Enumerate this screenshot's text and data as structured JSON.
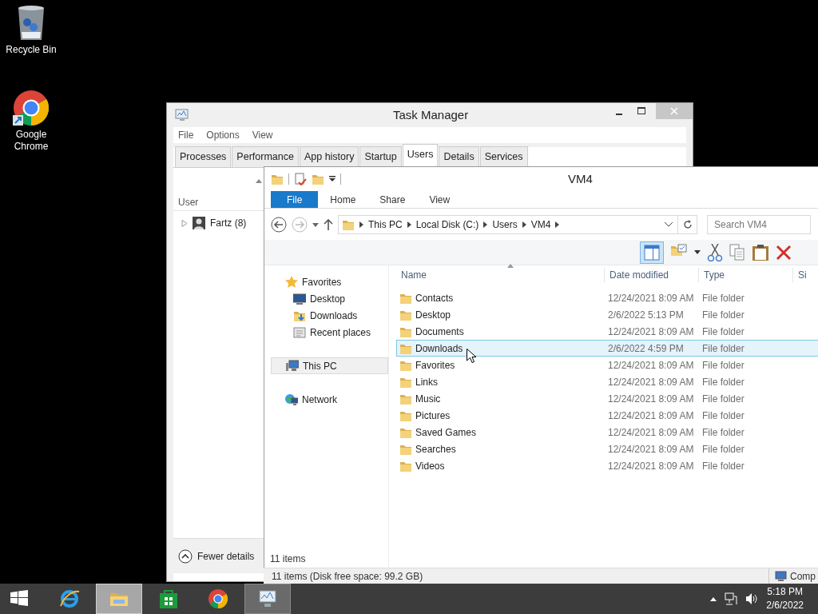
{
  "desktop_icons": [
    {
      "label": "Recycle Bin",
      "kind": "bin"
    },
    {
      "label": "Google Chrome",
      "kind": "chrome"
    }
  ],
  "task_manager": {
    "title": "Task Manager",
    "menu": [
      "File",
      "Options",
      "View"
    ],
    "tabs": [
      {
        "label": "Processes",
        "selected": false
      },
      {
        "label": "Performance",
        "selected": false
      },
      {
        "label": "App history",
        "selected": false
      },
      {
        "label": "Startup",
        "selected": false
      },
      {
        "label": "Users",
        "selected": true
      },
      {
        "label": "Details",
        "selected": false
      },
      {
        "label": "Services",
        "selected": false
      }
    ],
    "column": "User",
    "users": [
      {
        "name": "Fartz (8)",
        "expanded": false
      }
    ],
    "footer": "Fewer details"
  },
  "explorer": {
    "title": "VM4",
    "ribbon_tabs": [
      {
        "label": "File",
        "kind": "file"
      },
      {
        "label": "Home",
        "kind": "tab"
      },
      {
        "label": "Share",
        "kind": "tab"
      },
      {
        "label": "View",
        "kind": "tab"
      }
    ],
    "breadcrumbs": [
      "This PC",
      "Local Disk (C:)",
      "Users",
      "VM4"
    ],
    "search": {
      "placeholder": "Search VM4"
    },
    "nav": [
      {
        "label": "Favorites",
        "kind": "star",
        "selected": false,
        "children": [
          {
            "label": "Desktop",
            "kind": "desktop",
            "selected": false
          },
          {
            "label": "Downloads",
            "kind": "downloads",
            "selected": false
          },
          {
            "label": "Recent places",
            "kind": "recent",
            "selected": false
          }
        ]
      },
      {
        "label": "This PC",
        "kind": "pc",
        "selected": true
      },
      {
        "label": "Network",
        "kind": "network",
        "selected": false
      }
    ],
    "columns": [
      "Name",
      "Date modified",
      "Type",
      "Si"
    ],
    "rows": [
      {
        "name": "Contacts",
        "date": "12/24/2021 8:09 AM",
        "type": "File folder",
        "selected": false
      },
      {
        "name": "Desktop",
        "date": "2/6/2022 5:13 PM",
        "type": "File folder",
        "selected": false
      },
      {
        "name": "Documents",
        "date": "12/24/2021 8:09 AM",
        "type": "File folder",
        "selected": false
      },
      {
        "name": "Downloads",
        "date": "2/6/2022 4:59 PM",
        "type": "File folder",
        "selected": true
      },
      {
        "name": "Favorites",
        "date": "12/24/2021 8:09 AM",
        "type": "File folder",
        "selected": false
      },
      {
        "name": "Links",
        "date": "12/24/2021 8:09 AM",
        "type": "File folder",
        "selected": false
      },
      {
        "name": "Music",
        "date": "12/24/2021 8:09 AM",
        "type": "File folder",
        "selected": false
      },
      {
        "name": "Pictures",
        "date": "12/24/2021 8:09 AM",
        "type": "File folder",
        "selected": false
      },
      {
        "name": "Saved Games",
        "date": "12/24/2021 8:09 AM",
        "type": "File folder",
        "selected": false
      },
      {
        "name": "Searches",
        "date": "12/24/2021 8:09 AM",
        "type": "File folder",
        "selected": false
      },
      {
        "name": "Videos",
        "date": "12/24/2021 8:09 AM",
        "type": "File folder",
        "selected": false
      }
    ],
    "item_count": "11 items",
    "status": "11 items (Disk free space: 99.2 GB)",
    "status_right": "Comp"
  },
  "taskbar": {
    "apps": [
      {
        "kind": "start",
        "selected": false,
        "open": false
      },
      {
        "kind": "ie",
        "selected": false,
        "open": false
      },
      {
        "kind": "explorer",
        "selected": true,
        "open": true
      },
      {
        "kind": "store",
        "selected": false,
        "open": false
      },
      {
        "kind": "chrome",
        "selected": false,
        "open": false
      },
      {
        "kind": "taskmgr",
        "selected": false,
        "open": true
      }
    ],
    "time": "5:18 PM",
    "date": "2/6/2022"
  }
}
